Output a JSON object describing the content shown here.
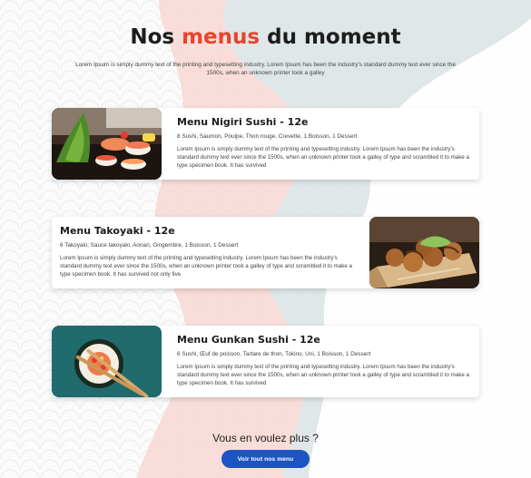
{
  "header": {
    "title_before": "Nos ",
    "title_accent": "menus",
    "title_after": " du moment",
    "subtitle": "Lorem Ipsum is simply dummy text of the printing and typesetting industry. Lorem Ipsum has been the industry's standard dummy text ever since the 1500s, when an unknown printer took a galley"
  },
  "menus": [
    {
      "title": "Menu Nigiri Sushi - 12e",
      "items": "8 Sushi, Saumon, Poulpe, Thon rouge, Crevette, 1 Boisson, 1 Dessert",
      "description": "Lorem Ipsum is simply dummy text of the printing and typesetting industry. Lorem Ipsum has been the industry's standard dummy text ever since the 1500s, when an unknown printer took a galley of type and scrambled it to make a type specimen book. It has survived"
    },
    {
      "title": "Menu Takoyaki - 12e",
      "items": "6 Takoyaki, Sauce takoyaki, Aonari, Gingembre, 1 Boisson, 1 Dessert",
      "description": "Lorem Ipsum is simply dummy text of the printing and typesetting industry. Lorem Ipsum has been the industry's standard dummy text ever since the 1500s, when an unknown printer took a galley of type and scrambled it to make a type specimen book. It has survived not only five"
    },
    {
      "title": "Menu Gunkan Sushi - 12e",
      "items": "6 Sushi, Œuf de poisson, Tartare de thon, Tokino, Uni, 1 Boisson, 1 Dessert",
      "description": "Lorem Ipsum is simply dummy text of the printing and typesetting industry. Lorem Ipsum has been the industry's standard dummy text ever since the 1500s, when an unknown printer took a galley of type and scrambled it to make a type specimen book. It has survived"
    }
  ],
  "footer": {
    "more_title": "Vous en voulez plus ?",
    "cta_label": "Voir tout nos menu"
  },
  "colors": {
    "accent": "#e8442b",
    "button": "#1c55c3"
  }
}
